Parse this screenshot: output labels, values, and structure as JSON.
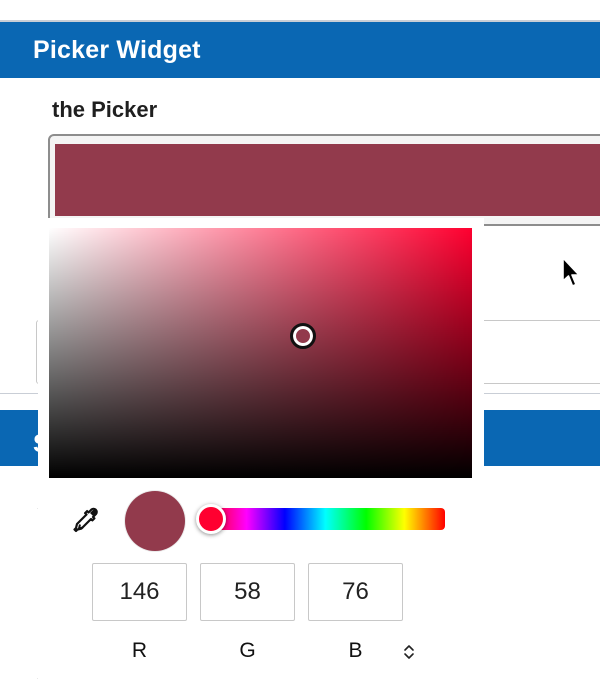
{
  "sections": {
    "first_title": "Picker Widget",
    "second_title": "S"
  },
  "field": {
    "label": "the Picker",
    "selected_color": "#923a4c"
  },
  "background_labels": {
    "label_1": "s",
    "label_2": "s"
  },
  "picker": {
    "hue_color": "#ff0030",
    "hue_position": 0.02,
    "saturation": 0.6,
    "brightness": 0.57,
    "preview_color": "#923a4c",
    "rgb": {
      "r": "146",
      "g": "58",
      "b": "76"
    },
    "labels": {
      "r": "R",
      "g": "G",
      "b": "B"
    }
  },
  "icons": {
    "eyedropper": "eyedropper-icon",
    "mode_toggle": "chevron-updown-icon",
    "cursor": "mouse-pointer-icon"
  },
  "colors": {
    "header_blue": "#0a67b3",
    "selected": "#923a4c",
    "hue": "#ff0030"
  }
}
